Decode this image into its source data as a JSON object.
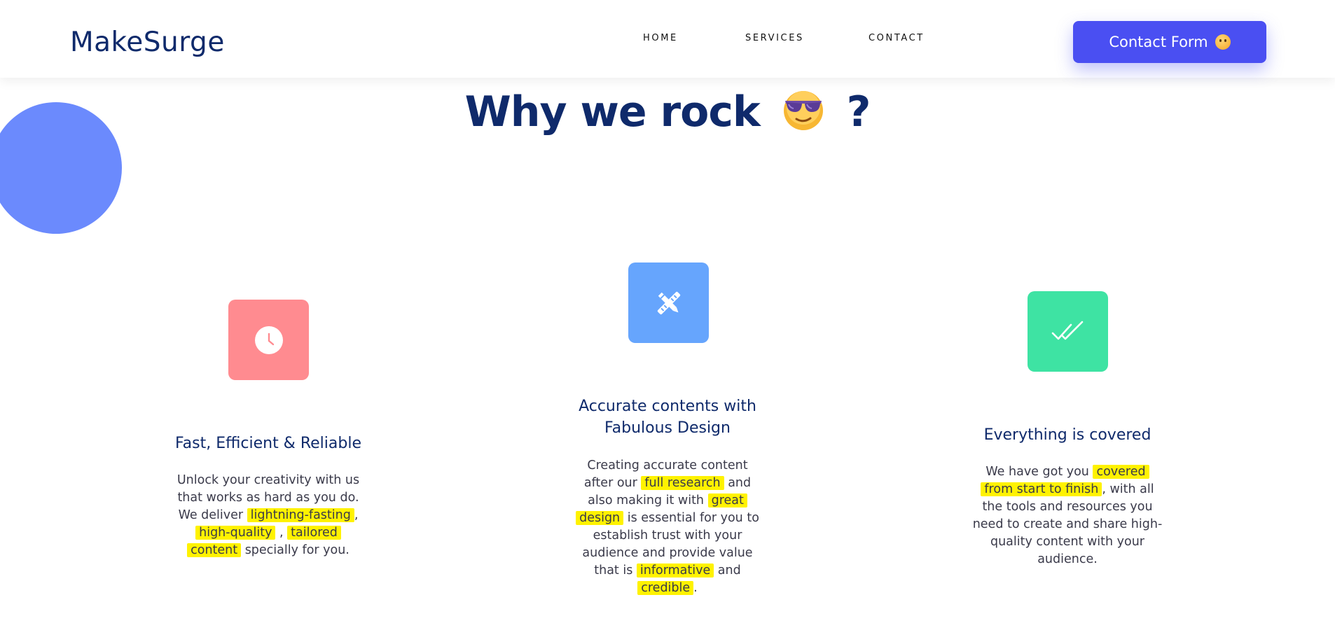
{
  "header": {
    "logo": "MakeSurge",
    "nav": {
      "home": "HOME",
      "services": "SERVICES",
      "contact": "CONTACT"
    },
    "cta_label": "Contact Form"
  },
  "section": {
    "title_before": "Why we rock",
    "title_after": "?"
  },
  "cards": [
    {
      "icon": "clock-icon",
      "title": "Fast, Efficient & Reliable",
      "text": {
        "l1": "Unlock your creativity with us",
        "l2": "that works as hard as you do.",
        "l3a": "We deliver ",
        "h1": "lightning-fasting",
        "l3b": ",",
        "h2": "high-quality",
        "l4a": " , ",
        "h3": "tailored",
        "h4": "content",
        "l5": " specially for you."
      }
    },
    {
      "icon": "tools-icon",
      "title_l1": "Accurate contents with",
      "title_l2": "Fabulous Design",
      "text": {
        "l1": "Creating accurate content",
        "l2a": "after our ",
        "h1": "full research",
        "l2b": " and",
        "l3a": "also making it with ",
        "h2": "great",
        "h3": "design",
        "l4": " is essential for you to",
        "l5": "establish trust with your",
        "l6": "audience and provide value",
        "l7a": "that is ",
        "h4": "informative",
        "l7b": " and",
        "h5": "credible",
        "l8": "."
      }
    },
    {
      "icon": "double-check-icon",
      "title": "Everything is covered",
      "text": {
        "l1a": "We have got you ",
        "h1": "covered",
        "h2": "from start to finish",
        "l2b": ", with all",
        "l3": "the tools and resources you",
        "l4": "need to create and share high-",
        "l5": "quality content with your",
        "l6": "audience."
      }
    }
  ],
  "colors": {
    "brand_navy": "#0f2a6b",
    "cta_blue": "#4a4ff2",
    "circle_blue": "#6b8afd",
    "clock_bg": "#ff8b90",
    "tools_bg": "#66a5fd",
    "check_bg": "#3ee3a3",
    "highlight": "#fff200"
  }
}
